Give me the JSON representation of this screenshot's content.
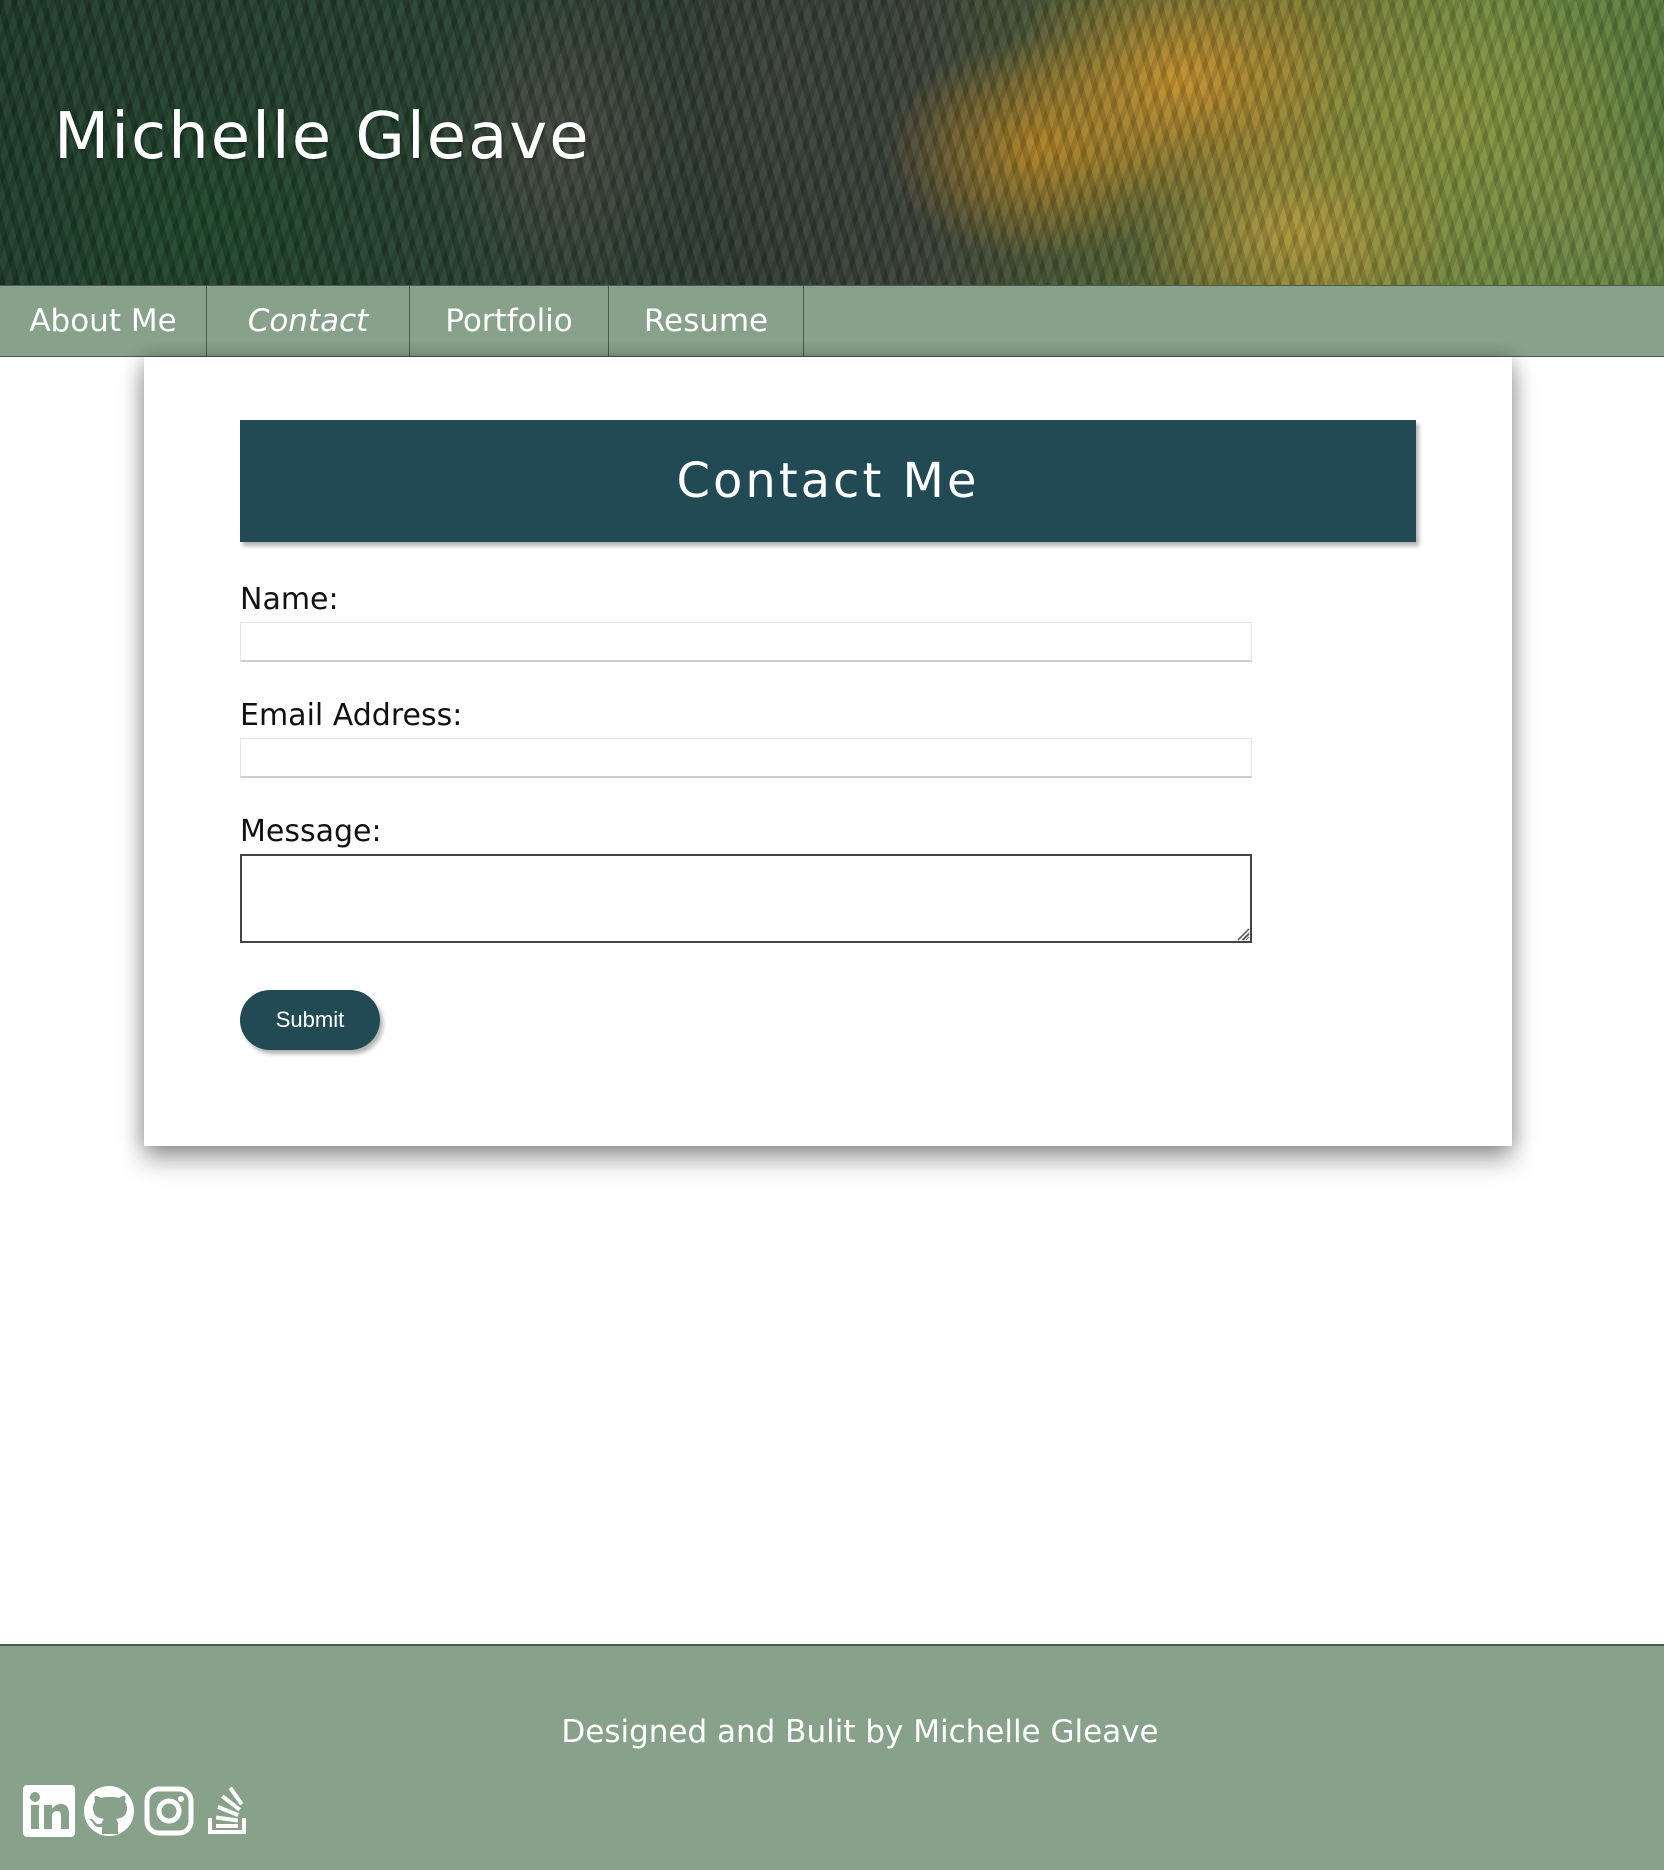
{
  "header": {
    "title": "Michelle Gleave"
  },
  "nav": {
    "items": [
      {
        "label": "About Me"
      },
      {
        "label": "Contact"
      },
      {
        "label": "Portfolio"
      },
      {
        "label": "Resume"
      }
    ],
    "active": "Contact"
  },
  "contact": {
    "heading": "Contact Me",
    "name_label": "Name:",
    "name_value": "",
    "email_label": "Email Address:",
    "email_value": "",
    "message_label": "Message:",
    "message_value": "",
    "submit_label": "Submit"
  },
  "footer": {
    "credit": "Designed and Bulit by Michelle Gleave",
    "social_icons": [
      "linkedin-icon",
      "github-icon",
      "instagram-icon",
      "stack-overflow-icon"
    ]
  },
  "colors": {
    "nav_green": "#88a18b",
    "header_teal": "#224a54",
    "button_teal": "#224a54"
  }
}
